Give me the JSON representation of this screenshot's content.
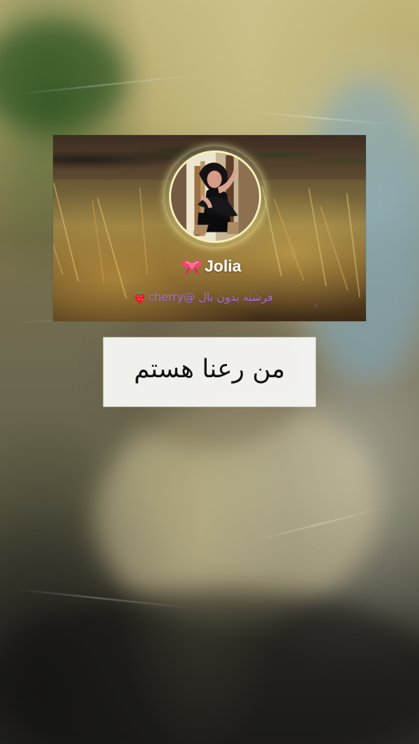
{
  "profile": {
    "name": "Jolia",
    "bio": "فرشته بدون بال @cherry",
    "bow_icon": "ribbon-bow-icon",
    "strawberry_icon": "strawberry-icon",
    "accent_bio_color": "#a16de1"
  },
  "caption": {
    "text": "من رعنا هستم"
  },
  "visual": {
    "background_image": "blurred-river-dress-background",
    "avatar_image": "profile-avatar-photo",
    "card_image": "golden-grass-profile-card"
  }
}
